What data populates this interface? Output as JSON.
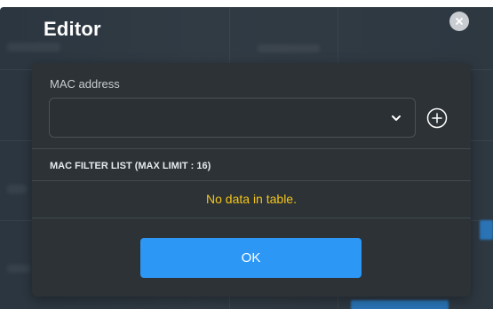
{
  "editor": {
    "title": "Editor",
    "mac_address": {
      "label": "MAC address",
      "value": "",
      "placeholder": ""
    },
    "list_header": "MAC FILTER LIST (MAX LIMIT : 16)",
    "empty_message": "No data in table.",
    "ok_label": "OK"
  },
  "icons": {
    "close": "close-icon",
    "chevron": "chevron-down-icon",
    "add": "add-circle-icon"
  },
  "colors": {
    "ok_button": "#2d97f5",
    "empty_message": "#f5c518",
    "panel": "#2c3236"
  }
}
